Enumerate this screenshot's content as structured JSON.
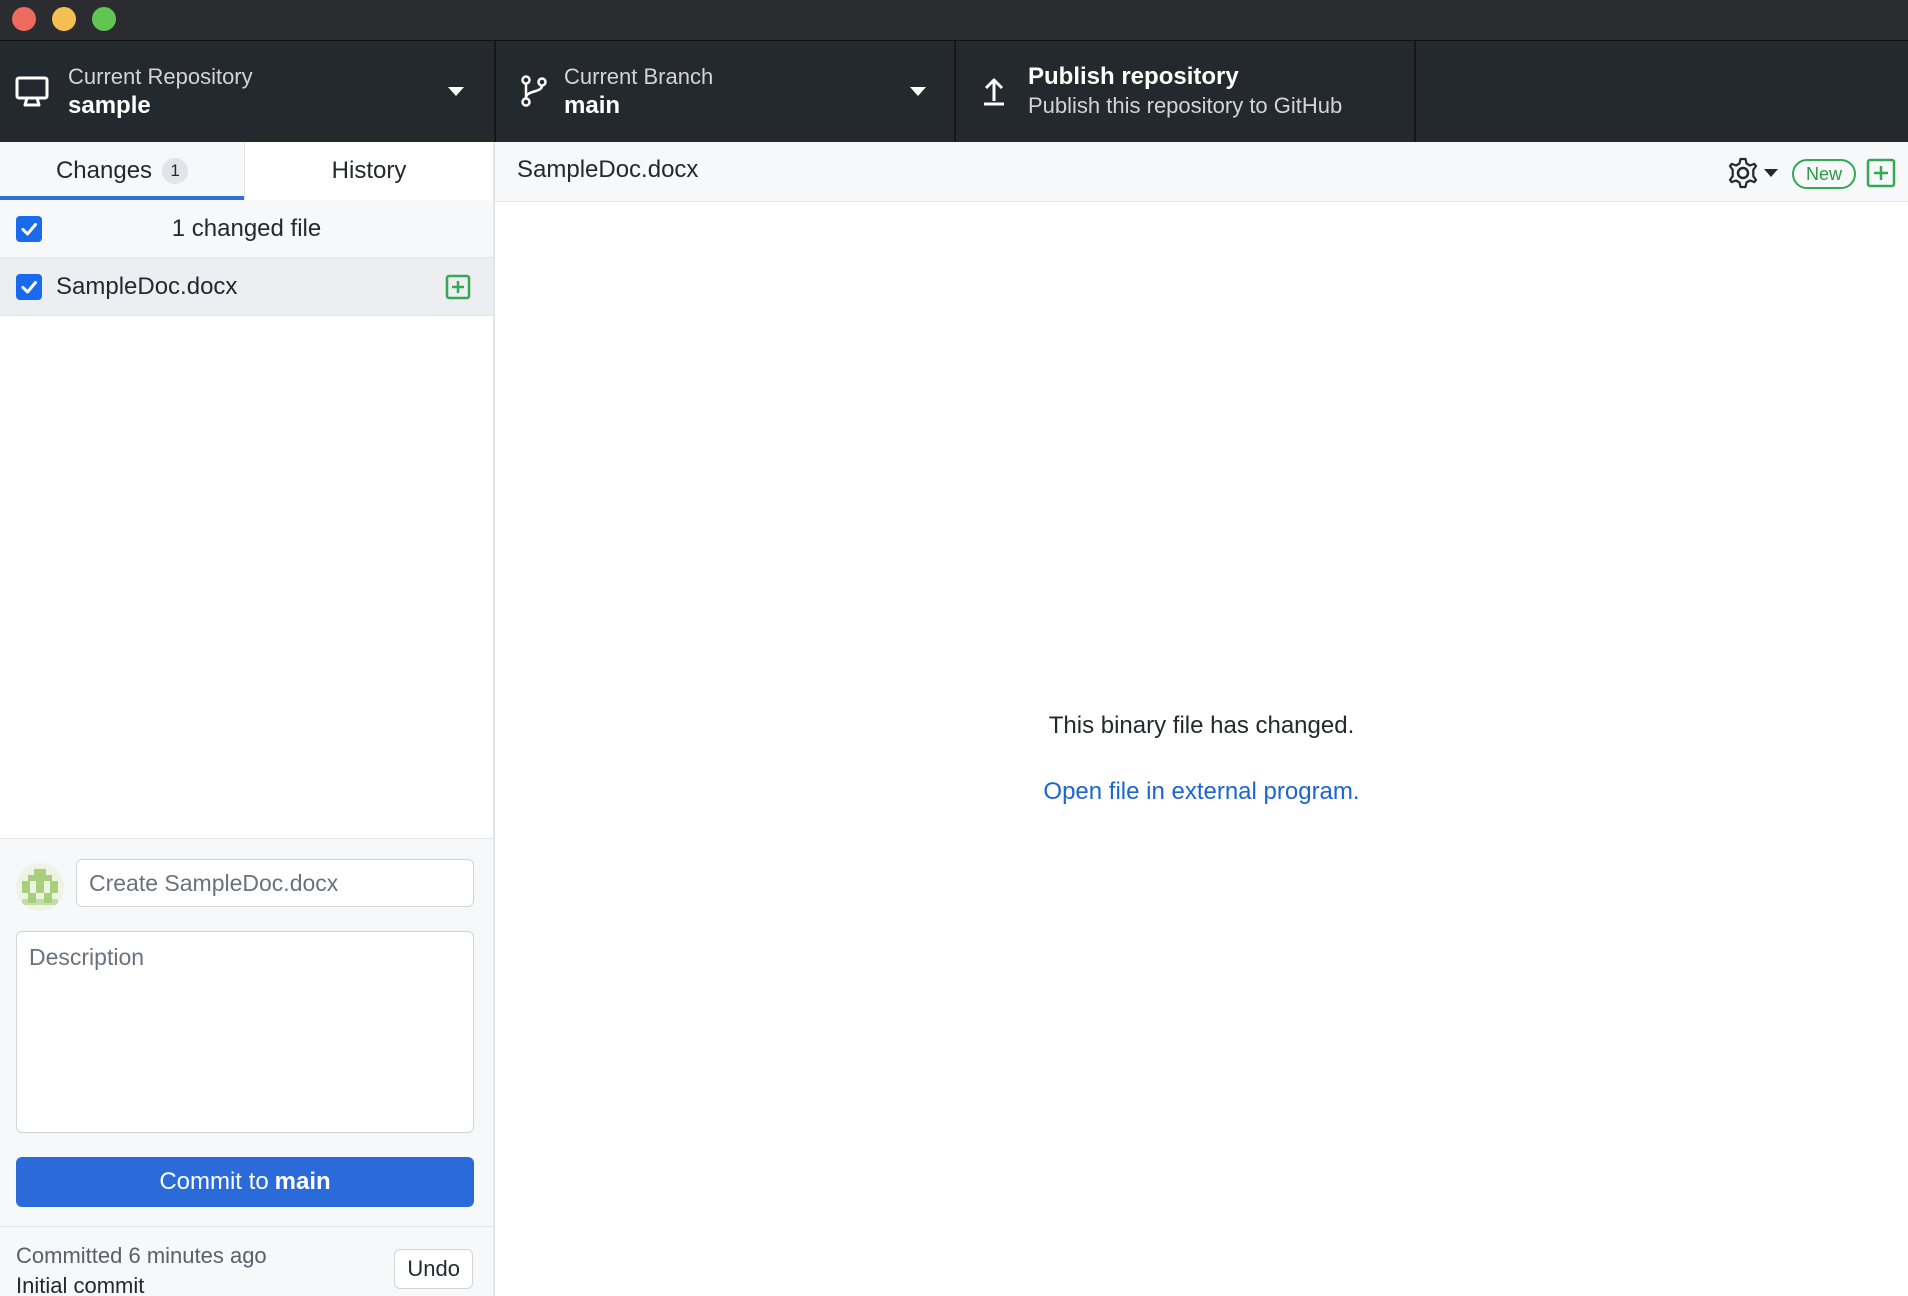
{
  "toolbar": {
    "repository": {
      "label": "Current Repository",
      "value": "sample"
    },
    "branch": {
      "label": "Current Branch",
      "value": "main"
    },
    "publish": {
      "label": "Publish repository",
      "value": "Publish this repository to GitHub"
    }
  },
  "sidebar": {
    "tabs": [
      {
        "label": "Changes",
        "badge": "1"
      },
      {
        "label": "History"
      }
    ],
    "changed_header": "1 changed file",
    "files": [
      {
        "name": "SampleDoc.docx",
        "status": "added"
      }
    ],
    "commit": {
      "summary_placeholder": "Create SampleDoc.docx",
      "description_placeholder": "Description",
      "button_prefix": "Commit to",
      "button_branch": "main"
    },
    "last_commit": {
      "meta": "Committed 6 minutes ago",
      "message": "Initial commit",
      "undo_label": "Undo"
    }
  },
  "main": {
    "title": "SampleDoc.docx",
    "new_badge": "New",
    "binary_message": "This binary file has changed.",
    "open_link": "Open file in external program."
  },
  "colors": {
    "accent": "#2a6ad9",
    "toolbar_bg": "#24292e",
    "added_green": "#34a853",
    "link_blue": "#1a64d8"
  }
}
